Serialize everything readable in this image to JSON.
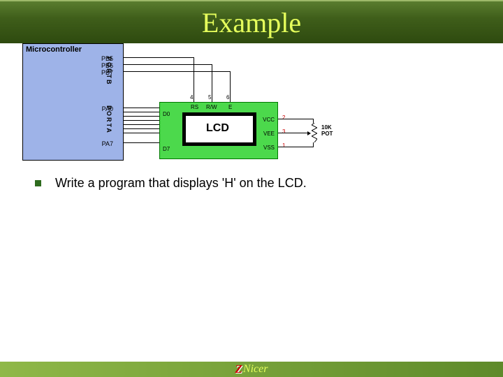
{
  "title": "Example",
  "diagram": {
    "mcu_label": "Microcontroller",
    "portb_label": "PORTB",
    "porta_label": "PORTA",
    "pins_b": [
      "PB5",
      "PB6",
      "PB7"
    ],
    "pins_a": [
      "PA0",
      "PA7"
    ],
    "lcd_text": "LCD",
    "lcd_top_pins": [
      "RS",
      "R/W",
      "E"
    ],
    "lcd_top_nums": [
      "4",
      "5",
      "6"
    ],
    "lcd_left_pins": [
      "D0",
      "D7"
    ],
    "lcd_right_pins": [
      "VCC",
      "VEE",
      "VSS"
    ],
    "lcd_right_nums": [
      "2",
      "3",
      "1"
    ],
    "pot_label": "10K\nPOT"
  },
  "bullet": {
    "text": "Write a program that displays 'H' on the LCD."
  },
  "footer": {
    "logo_z": "Z",
    "logo_nicer": "Nicer"
  }
}
